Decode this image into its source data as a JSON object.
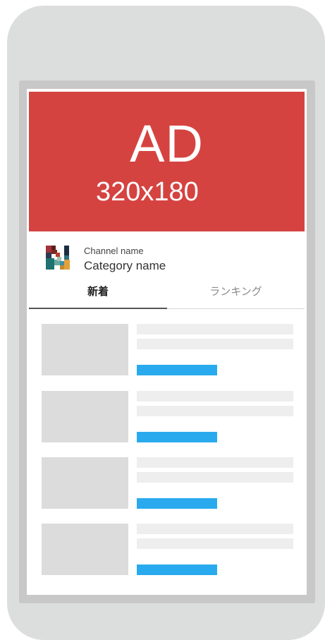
{
  "ad": {
    "title": "AD",
    "size": "320x180",
    "background": "#d54341"
  },
  "channel": {
    "logo_icon": "channel-logo-icon",
    "name": "Channel name",
    "category": "Category name"
  },
  "tabs": [
    {
      "label": "新着",
      "active": true
    },
    {
      "label": "ランキング",
      "active": false
    }
  ],
  "colors": {
    "accent_bar": "#2aaaee",
    "placeholder": "#dcdcdc",
    "line": "#eeeeee",
    "frame": "#dcdedd"
  },
  "list": {
    "item_count": 4
  }
}
